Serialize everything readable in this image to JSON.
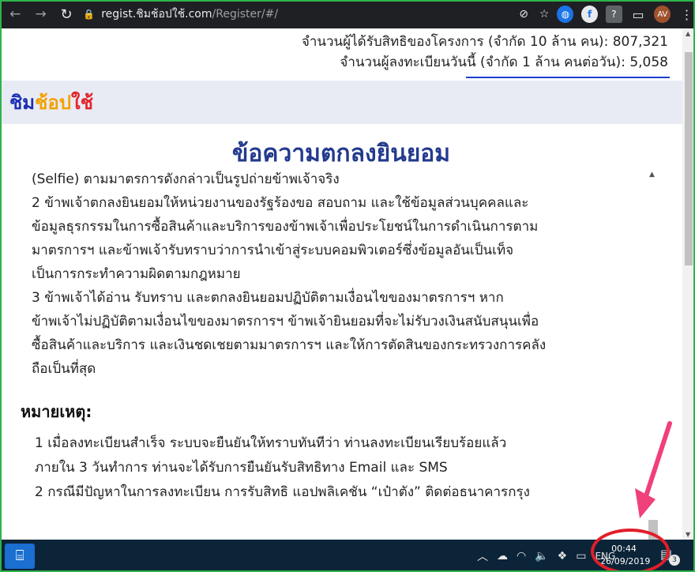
{
  "browser": {
    "url_domain": "regist.ชิมช้อปใช้.com",
    "url_path": "/Register/#/",
    "avatar_label": "AV",
    "help_label": "?"
  },
  "stats": {
    "registered_total": "จำนวนผู้ได้รับสิทธิของโครงการ (จำกัด 10 ล้าน คน): 807,321",
    "registered_today": "จำนวนผู้ลงทะเบียนวันนี้ (จำกัด 1 ล้าน คนต่อวัน): 5,058"
  },
  "brand": {
    "part1": "ชิม",
    "part2": "ช้อป",
    "part3": "ใช้",
    "c1": "#1b2fb5",
    "c2": "#f2a100",
    "c3": "#e3252d"
  },
  "page": {
    "title": "ข้อความตกลงยินยอม"
  },
  "agreement": {
    "lines": [
      "(Selfie) ตามมาตรการดังกล่าวเป็นรูปถ่ายข้าพเจ้าจริง",
      "2  ข้าพเจ้าตกลงยินยอมให้หน่วยงานของรัฐร้องขอ สอบถาม และใช้ข้อมูลส่วนบุคคลและ",
      "ข้อมูลธุรกรรมในการซื้อสินค้าและบริการของข้าพเจ้าเพื่อประโยชน์ในการดำเนินการตาม",
      "มาตรการฯ และข้าพเจ้ารับทราบว่าการนำเข้าสู่ระบบคอมพิวเตอร์ซึ่งข้อมูลอันเป็นเท็จ",
      "เป็นการกระทำความผิดตามกฎหมาย",
      "3  ข้าพเจ้าได้อ่าน รับทราบ และตกลงยินยอมปฏิบัติตามเงื่อนไขของมาตรการฯ หาก",
      "ข้าพเจ้าไม่ปฏิบัติตามเงื่อนไขของมาตรการฯ ข้าพเจ้ายินยอมที่จะไม่รับวงเงินสนับสนุนเพื่อ",
      "ซื้อสินค้าและบริการ และเงินชดเชยตามมาตรการฯ และให้การตัดสินของกระทรวงการคลัง",
      "ถือเป็นที่สุด"
    ]
  },
  "notes": {
    "title": "หมายเหตุ:",
    "lines": [
      "1  เมื่อลงทะเบียนสำเร็จ ระบบจะยืนยันให้ทราบทันทีว่า ท่านลงทะเบียนเรียบร้อยแล้ว",
      "ภายใน 3 วันทำการ ท่านจะได้รับการยืนยันรับสิทธิทาง Email และ SMS",
      "2  กรณีมีปัญหาในการลงทะเบียน การรับสิทธิ แอปพลิเคชัน “เป๋าตัง” ติดต่อธนาคารกรุง"
    ]
  },
  "taskbar": {
    "lang": "ENG",
    "time": "00:44",
    "date": "26/09/2019",
    "notif_count": "3"
  },
  "colors": {
    "highlight_circle": "#e21e2a",
    "highlight_arrow": "#f0407a",
    "frame": "#2fb34a"
  }
}
